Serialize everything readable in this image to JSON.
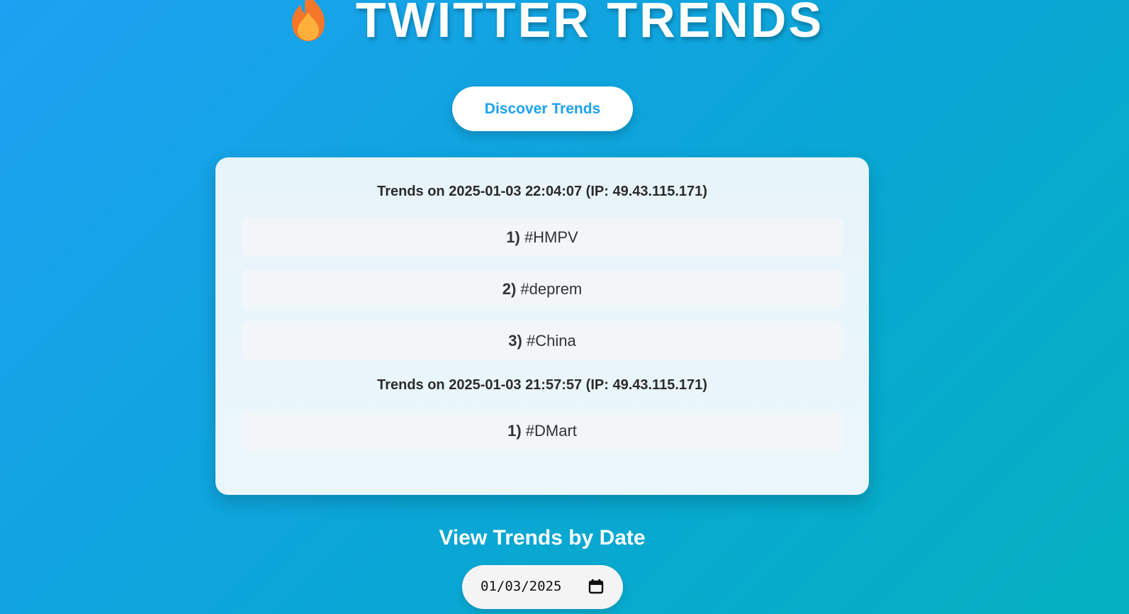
{
  "header": {
    "title": "TWITTER TRENDS",
    "icon": "flame-icon"
  },
  "discover_button": {
    "label": "Discover Trends"
  },
  "trend_groups": [
    {
      "heading": "Trends on 2025-01-03 22:04:07 (IP: 49.43.115.171)",
      "items": [
        {
          "rank": "1)",
          "tag": "#HMPV"
        },
        {
          "rank": "2)",
          "tag": "#deprem"
        },
        {
          "rank": "3)",
          "tag": "#China"
        }
      ]
    },
    {
      "heading": "Trends on 2025-01-03 21:57:57 (IP: 49.43.115.171)",
      "items": [
        {
          "rank": "1)",
          "tag": "#DMart"
        }
      ]
    }
  ],
  "date_section": {
    "heading": "View Trends by Date",
    "date_value": "01/03/2025",
    "icon": "calendar-icon"
  },
  "colors": {
    "accent": "#1da1f2",
    "card_background": "#e8f5fa",
    "item_background": "#f2f6f9"
  }
}
